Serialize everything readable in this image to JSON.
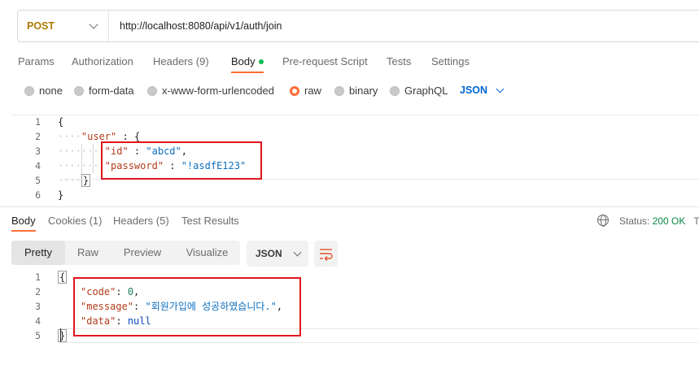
{
  "request": {
    "method": "POST",
    "url": "http://localhost:8080/api/v1/auth/join",
    "method_color": "#ad7a03"
  },
  "request_tabs": [
    {
      "label": "Params"
    },
    {
      "label": "Authorization"
    },
    {
      "label": "Headers",
      "count": "(9)"
    },
    {
      "label": "Body",
      "active": true,
      "indicator": "green-dot"
    },
    {
      "label": "Pre-request Script"
    },
    {
      "label": "Tests"
    },
    {
      "label": "Settings"
    }
  ],
  "body_types": [
    {
      "label": "none"
    },
    {
      "label": "form-data"
    },
    {
      "label": "x-www-form-urlencoded"
    },
    {
      "label": "raw",
      "selected": true
    },
    {
      "label": "binary"
    },
    {
      "label": "GraphQL"
    }
  ],
  "raw_format": "JSON",
  "request_body": {
    "line_numbers": [
      "1",
      "2",
      "3",
      "4",
      "5",
      "6"
    ],
    "lines": {
      "l1": "{",
      "l2_key": "\"user\"",
      "l2_rest": " : {",
      "l3_key": "\"id\"",
      "l3_sep": " : ",
      "l3_val": "\"abcd\"",
      "l3_end": ",",
      "l4_key": "\"password\"",
      "l4_sep": " : ",
      "l4_val": "\"!asdfE123\"",
      "l5": "}",
      "l6": "}"
    }
  },
  "response_tabs": [
    {
      "label": "Body",
      "active": true
    },
    {
      "label": "Cookies",
      "count": "(1)"
    },
    {
      "label": "Headers",
      "count": "(5)"
    },
    {
      "label": "Test Results"
    }
  ],
  "status": {
    "label": "Status:",
    "value": "200 OK",
    "trailing": "T",
    "icon": "globe-icon",
    "ok_color": "#0a8a43"
  },
  "response_view_modes": [
    "Pretty",
    "Raw",
    "Preview",
    "Visualize"
  ],
  "response_format": "JSON",
  "wrap_icon": "wrap-lines-icon",
  "response_body": {
    "line_numbers": [
      "1",
      "2",
      "3",
      "4",
      "5"
    ],
    "lines": {
      "l1": "{",
      "l2_key": "\"code\"",
      "l2_sep": ": ",
      "l2_val": "0",
      "l2_end": ",",
      "l3_key": "\"message\"",
      "l3_sep": ": ",
      "l3_val": "\"회원가입에 성공하였습니다.\"",
      "l3_end": ",",
      "l4_key": "\"data\"",
      "l4_sep": ": ",
      "l4_val": "null",
      "l5": "}"
    }
  },
  "colors": {
    "accent": "#ff6c37",
    "json_blue": "#0265d2",
    "highlight_box": "#e2151d"
  }
}
